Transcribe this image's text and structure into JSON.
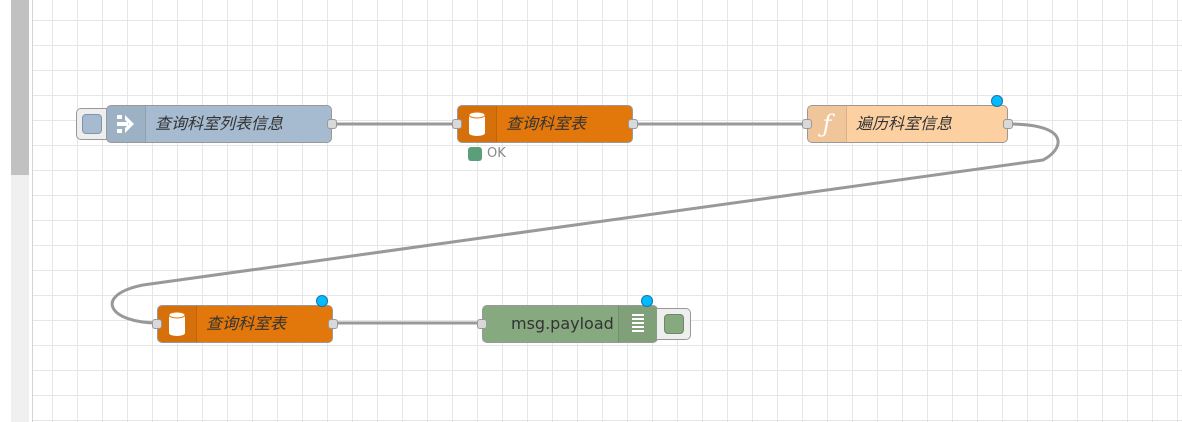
{
  "nodes": {
    "inject": {
      "label": "查询科室列表信息",
      "color": "#a6bbcf",
      "icon": "arrow-in-icon"
    },
    "db1": {
      "label": "查询科室表",
      "color": "#e2770b",
      "icon": "database-icon"
    },
    "func": {
      "label": "遍历科室信息",
      "color": "#fdd0a2",
      "icon": "function-icon"
    },
    "db2": {
      "label": "查询科室表",
      "color": "#e2770b",
      "icon": "database-icon"
    },
    "debug": {
      "label": "msg.payload",
      "color": "#87a980",
      "icon": "list-icon"
    }
  },
  "status": {
    "db1": "OK"
  }
}
